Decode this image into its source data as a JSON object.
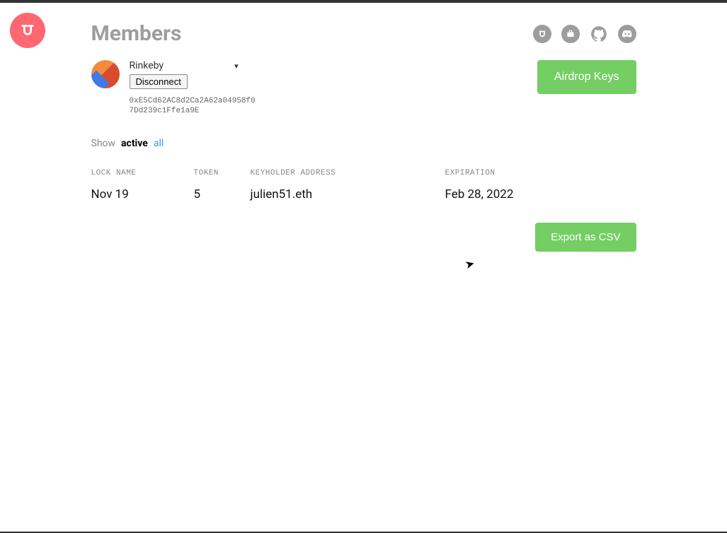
{
  "page": {
    "title": "Members"
  },
  "wallet": {
    "network": "Rinkeby",
    "disconnect_label": "Disconnect",
    "address": "0xE5Cd62AC8d2Ca2A62a04958f07Dd239c1Ffe1a9E"
  },
  "actions": {
    "airdrop_label": "Airdrop Keys",
    "export_label": "Export as CSV"
  },
  "filter": {
    "show_label": "Show",
    "active_label": "active",
    "all_label": "all"
  },
  "table": {
    "headers": {
      "lock_name": "LOCK NAME",
      "token": "TOKEN",
      "keyholder": "KEYHOLDER ADDRESS",
      "expiration": "EXPIRATION"
    },
    "rows": [
      {
        "lock_name": "Nov 19",
        "token": "5",
        "keyholder": "julien51.eth",
        "expiration": "Feb 28, 2022"
      }
    ]
  },
  "icons": {
    "logo": "unlock",
    "social": [
      "unlock",
      "briefcase",
      "github",
      "discord"
    ]
  }
}
